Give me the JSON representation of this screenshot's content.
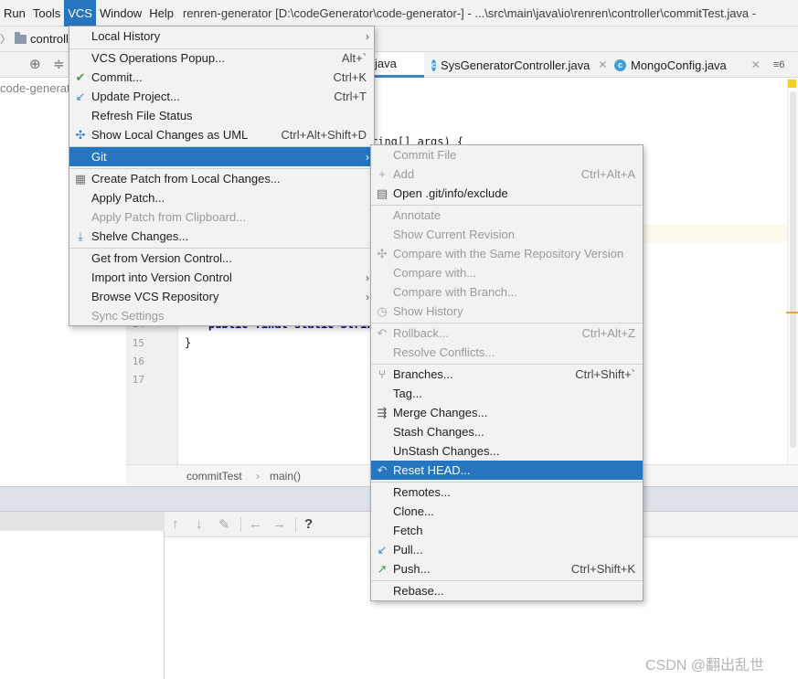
{
  "menubar": {
    "items": [
      "Run",
      "Tools",
      "VCS",
      "Window",
      "Help"
    ],
    "window_title": "renren-generator [D:\\codeGenerator\\code-generator-] - ...\\src\\main\\java\\io\\renren\\controller\\commitTest.java -"
  },
  "nav": {
    "crumb": "controll"
  },
  "project": {
    "root_node": "code-generato"
  },
  "tabs": [
    {
      "label": "java",
      "active": true
    },
    {
      "label": "SysGeneratorController.java",
      "active": false
    },
    {
      "label": "MongoConfig.java",
      "active": false
    }
  ],
  "tabs_overflow": "≡6",
  "editor": {
    "code_main": "ring[] args) {",
    "code_field": "public final static String",
    "code_close": "}",
    "line_numbers": [
      "14",
      "15",
      "16",
      "17"
    ]
  },
  "breadcrumbs": [
    "commitTest",
    "main()"
  ],
  "vcs_menu": {
    "items": [
      {
        "label": "Local History",
        "shortcut": "",
        "submenu": true,
        "icon": ""
      },
      {
        "label": "VCS Operations Popup...",
        "shortcut": "Alt+`",
        "submenu": false,
        "icon": ""
      },
      {
        "label": "Commit...",
        "shortcut": "Ctrl+K",
        "submenu": false,
        "icon": "check-icon"
      },
      {
        "label": "Update Project...",
        "shortcut": "Ctrl+T",
        "submenu": false,
        "icon": "update-arrow-icon"
      },
      {
        "label": "Refresh File Status",
        "shortcut": "",
        "submenu": false,
        "icon": ""
      },
      {
        "label": "Show Local Changes as UML",
        "shortcut": "Ctrl+Alt+Shift+D",
        "submenu": false,
        "icon": "uml-icon"
      },
      {
        "label": "Git",
        "shortcut": "",
        "submenu": true,
        "icon": "",
        "selected": true
      },
      {
        "label": "Create Patch from Local Changes...",
        "shortcut": "",
        "submenu": false,
        "icon": "patch-icon"
      },
      {
        "label": "Apply Patch...",
        "shortcut": "",
        "submenu": false,
        "icon": ""
      },
      {
        "label": "Apply Patch from Clipboard...",
        "shortcut": "",
        "submenu": false,
        "icon": "",
        "disabled": true
      },
      {
        "label": "Shelve Changes...",
        "shortcut": "",
        "submenu": false,
        "icon": "shelve-icon"
      },
      {
        "label": "Get from Version Control...",
        "shortcut": "",
        "submenu": false,
        "icon": ""
      },
      {
        "label": "Import into Version Control",
        "shortcut": "",
        "submenu": true,
        "icon": ""
      },
      {
        "label": "Browse VCS Repository",
        "shortcut": "",
        "submenu": true,
        "icon": ""
      },
      {
        "label": "Sync Settings",
        "shortcut": "",
        "submenu": false,
        "icon": "",
        "disabled": true
      }
    ]
  },
  "git_menu": {
    "items": [
      {
        "label": "Commit File",
        "shortcut": "",
        "icon": "",
        "disabled": true
      },
      {
        "label": "Add",
        "shortcut": "Ctrl+Alt+A",
        "icon": "plus-icon",
        "disabled": true
      },
      {
        "label": "Open .git/info/exclude",
        "shortcut": "",
        "icon": "git-file-icon"
      },
      {
        "label": "Annotate",
        "shortcut": "",
        "icon": "",
        "disabled": true
      },
      {
        "label": "Show Current Revision",
        "shortcut": "",
        "icon": "",
        "disabled": true
      },
      {
        "label": "Compare with the Same Repository Version",
        "shortcut": "",
        "icon": "compare-icon",
        "disabled": true
      },
      {
        "label": "Compare with...",
        "shortcut": "",
        "icon": "",
        "disabled": true
      },
      {
        "label": "Compare with Branch...",
        "shortcut": "",
        "icon": "",
        "disabled": true
      },
      {
        "label": "Show History",
        "shortcut": "",
        "icon": "clock-icon",
        "disabled": true
      },
      {
        "label": "Rollback...",
        "shortcut": "Ctrl+Alt+Z",
        "icon": "rollback-icon",
        "disabled": true
      },
      {
        "label": "Resolve Conflicts...",
        "shortcut": "",
        "icon": "",
        "disabled": true
      },
      {
        "label": "Branches...",
        "shortcut": "Ctrl+Shift+`",
        "icon": "branch-icon"
      },
      {
        "label": "Tag...",
        "shortcut": "",
        "icon": ""
      },
      {
        "label": "Merge Changes...",
        "shortcut": "",
        "icon": "merge-icon"
      },
      {
        "label": "Stash Changes...",
        "shortcut": "",
        "icon": ""
      },
      {
        "label": "UnStash Changes...",
        "shortcut": "",
        "icon": ""
      },
      {
        "label": "Reset HEAD...",
        "shortcut": "",
        "icon": "reset-icon",
        "selected": true
      },
      {
        "label": "Remotes...",
        "shortcut": "",
        "icon": ""
      },
      {
        "label": "Clone...",
        "shortcut": "",
        "icon": ""
      },
      {
        "label": "Fetch",
        "shortcut": "",
        "icon": ""
      },
      {
        "label": "Pull...",
        "shortcut": "",
        "icon": "pull-icon"
      },
      {
        "label": "Push...",
        "shortcut": "Ctrl+Shift+K",
        "icon": "push-icon"
      },
      {
        "label": "Rebase...",
        "shortcut": "",
        "icon": ""
      }
    ]
  },
  "bottom_tools": {
    "help_label": "?"
  },
  "watermark": "CSDN @翻出乱世",
  "colors": {
    "selection": "#2675bf",
    "menu_bg": "#f2f2f2",
    "disabled_text": "#9a9a9a"
  }
}
